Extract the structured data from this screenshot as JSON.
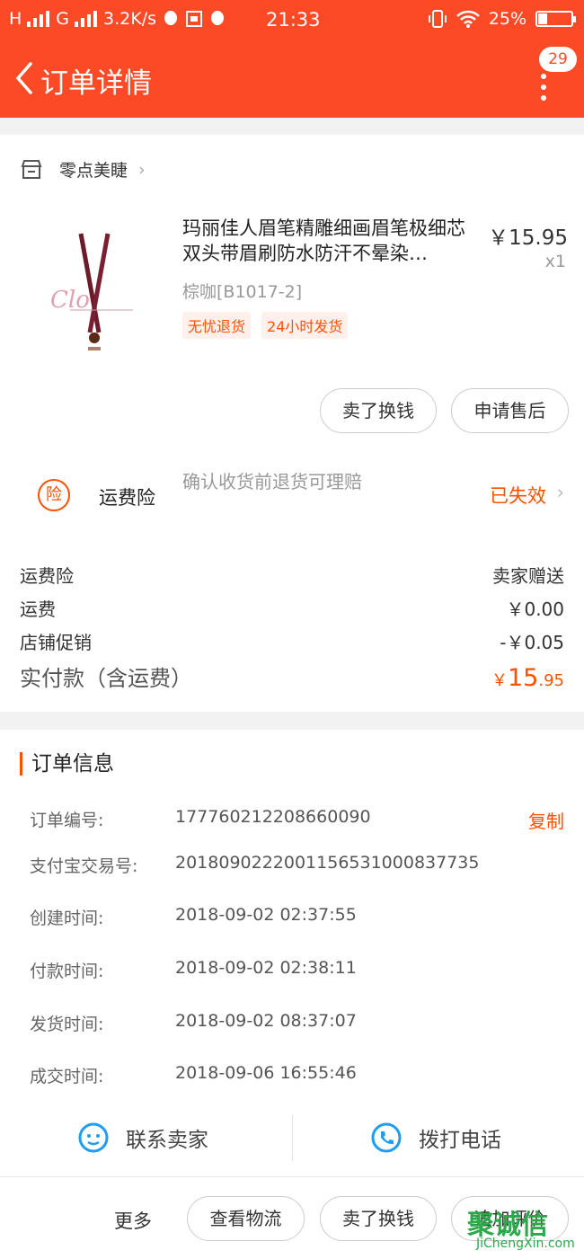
{
  "status_bar": {
    "signal_text": "H",
    "signal_text2": "G",
    "speed": "3.2K/s",
    "time": "21:33",
    "battery": "25%",
    "battery_level": 0.25
  },
  "header": {
    "title": "订单详情",
    "badge": "29"
  },
  "shop": {
    "name": "零点美睫"
  },
  "product": {
    "title": "玛丽佳人眉笔精雕细画眉笔极细芯双头带眉刷防水防汗不晕染…",
    "price": "￥15.95",
    "qty": "x1",
    "sku": "棕咖[B1017-2]",
    "tags": [
      "无忧退货",
      "24小时发货"
    ]
  },
  "actions": {
    "sell": "卖了换钱",
    "after_sale": "申请售后"
  },
  "insurance": {
    "icon_text": "险",
    "label": "运费险",
    "desc": "确认收货前退货可理赔",
    "status": "已失效"
  },
  "fees": [
    {
      "label": "运费险",
      "value": "卖家赠送"
    },
    {
      "label": "运费",
      "value": "￥0.00"
    },
    {
      "label": "店铺促销",
      "value": "-￥0.05"
    }
  ],
  "payment": {
    "label": "实付款（含运费）",
    "currency": "￥",
    "amount_int": "15",
    "amount_dec": ".95"
  },
  "order_info": {
    "title": "订单信息",
    "copy": "复制",
    "rows": [
      {
        "label": "订单编号:",
        "value": "177760212208660090"
      },
      {
        "label": "支付宝交易号:",
        "value": "2018090222001156531000837735"
      },
      {
        "label": "创建时间:",
        "value": "2018-09-02 02:37:55"
      },
      {
        "label": "付款时间:",
        "value": "2018-09-02 02:38:11"
      },
      {
        "label": "发货时间:",
        "value": "2018-09-02 08:37:07"
      },
      {
        "label": "成交时间:",
        "value": "2018-09-06 16:55:46"
      }
    ]
  },
  "contact": {
    "seller": "联系卖家",
    "call": "拨打电话"
  },
  "bottom": {
    "more": "更多",
    "logistics": "查看物流",
    "sell": "卖了换钱",
    "review": "追加评价"
  },
  "watermark": {
    "text": "聚诚信",
    "sub": "JiChengXin.com"
  },
  "colors": {
    "brand": "#fc4a27",
    "accent": "#ff5000"
  }
}
